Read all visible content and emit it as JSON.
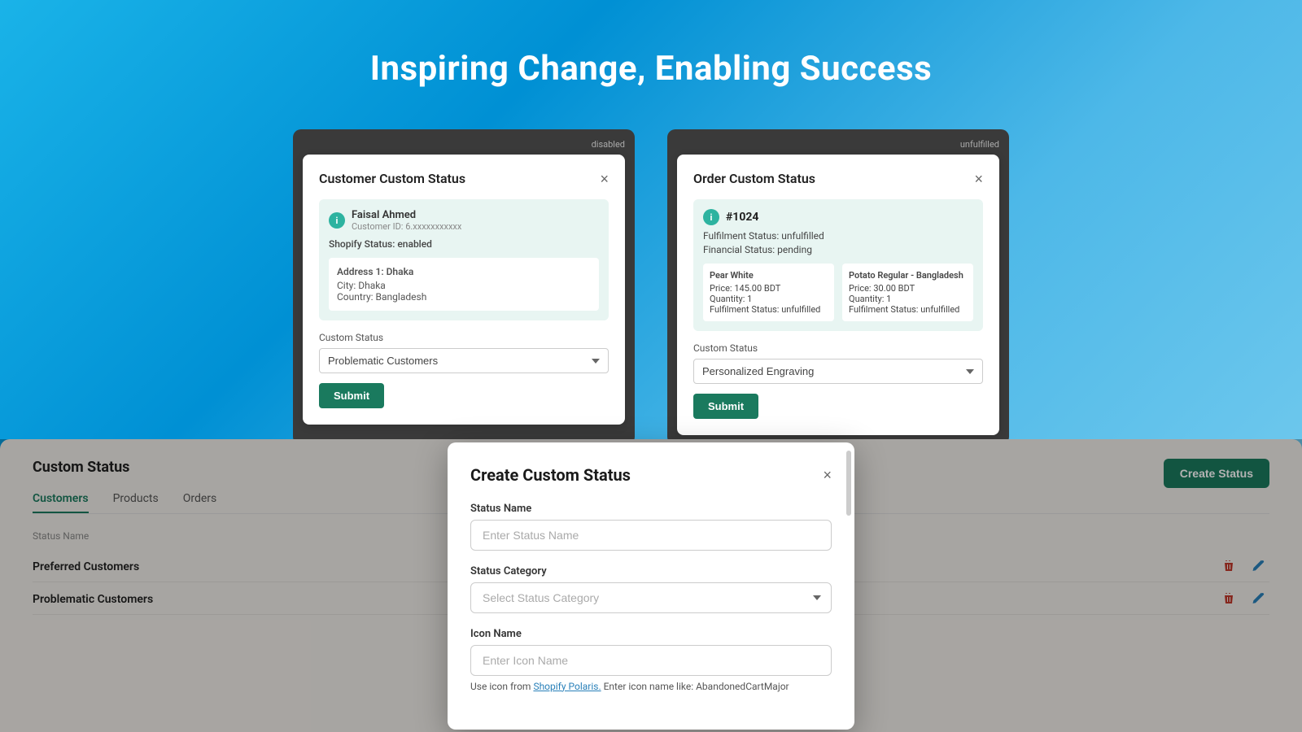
{
  "hero": {
    "title": "Inspiring Change, Enabling Success"
  },
  "customer_card": {
    "label_top": "disabled",
    "modal_title": "Customer Custom Status",
    "close_label": "×",
    "customer_name": "Faisal Ahmed",
    "customer_id": "Customer ID: 6.xxxxxxxxxxx",
    "shopify_status": "Shopify Status: enabled",
    "address_title": "Address 1: Dhaka",
    "address_city": "City: Dhaka",
    "address_country": "Country: Bangladesh",
    "custom_status_label": "Custom Status",
    "status_value": "Problematic Customers",
    "submit_label": "Submit"
  },
  "order_card": {
    "label_top": "unfulfilled",
    "modal_title": "Order Custom Status",
    "close_label": "×",
    "order_number": "#1024",
    "fulfillment_status": "Fulfilment Status: unfulfilled",
    "financial_status": "Financial Status: pending",
    "item1_name": "Pear White",
    "item1_price": "Price: 145.00 BDT",
    "item1_qty": "Quantity: 1",
    "item1_status": "Fulfilment Status: unfulfilled",
    "item2_name": "Potato Regular - Bangladesh",
    "item2_price": "Price: 30.00 BDT",
    "item2_qty": "Quantity: 1",
    "item2_status": "Fulfilment Status: unfulfilled",
    "custom_status_label": "Custom Status",
    "status_value": "Personalized Engraving",
    "submit_label": "Submit"
  },
  "bottom": {
    "section_title": "Custom Status",
    "tabs": [
      "Customers",
      "Products",
      "Orders"
    ],
    "active_tab": "Customers",
    "table_header": "Status Name",
    "rows": [
      {
        "name": "Preferred Customers"
      },
      {
        "name": "Problematic Customers"
      }
    ],
    "create_btn": "Create Status"
  },
  "create_modal": {
    "title": "Create Custom Status",
    "close_label": "×",
    "status_name_label": "Status Name",
    "status_name_placeholder": "Enter Status Name",
    "status_category_label": "Status Category",
    "status_category_placeholder": "Select Status Category",
    "icon_name_label": "Icon Name",
    "icon_name_placeholder": "Enter Icon Name",
    "hint_text": "Use icon from",
    "hint_link": "Shopify Polaris.",
    "hint_example": " Enter icon name like: AbandonedCartMajor"
  }
}
